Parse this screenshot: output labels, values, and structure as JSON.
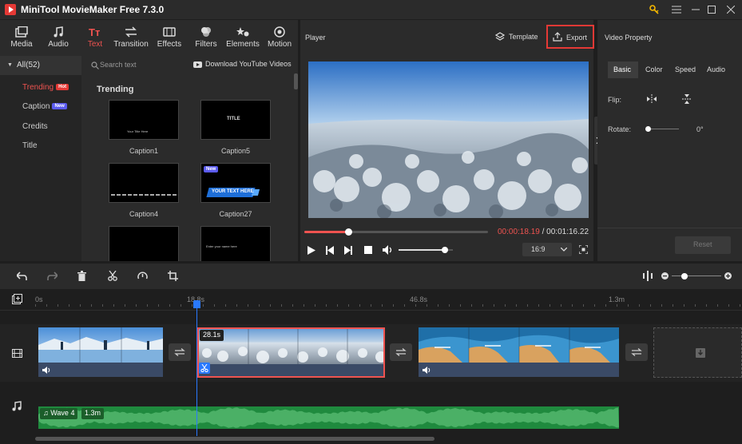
{
  "app": {
    "title": "MiniTool MovieMaker Free 7.3.0"
  },
  "toolbar_tabs": [
    {
      "label": "Media"
    },
    {
      "label": "Audio"
    },
    {
      "label": "Text"
    },
    {
      "label": "Transition"
    },
    {
      "label": "Effects"
    },
    {
      "label": "Filters"
    },
    {
      "label": "Elements"
    },
    {
      "label": "Motion"
    }
  ],
  "categories": {
    "all_label": "All(52)",
    "items": [
      {
        "label": "Trending",
        "badge": "Hot"
      },
      {
        "label": "Caption",
        "badge": "New"
      },
      {
        "label": "Credits"
      },
      {
        "label": "Title"
      }
    ]
  },
  "search": {
    "placeholder": "Search text"
  },
  "download_label": "Download YouTube Videos",
  "gallery": {
    "section": "Trending",
    "items": [
      {
        "label": "Caption1",
        "text": "Your Title Here"
      },
      {
        "label": "Caption5",
        "text": "TITLE"
      },
      {
        "label": "Caption4",
        "text": ""
      },
      {
        "label": "Caption27",
        "text": "YOUR TEXT HERE",
        "badge": "New"
      },
      {
        "label": "",
        "text": ""
      },
      {
        "label": "",
        "text": "Enter your name here"
      }
    ]
  },
  "player": {
    "title": "Player",
    "template_label": "Template",
    "export_label": "Export",
    "current_time": "00:00:18.19",
    "separator": "/",
    "total_time": "00:01:16.22",
    "aspect": "16:9",
    "progress": 0.24,
    "volume": 0.85
  },
  "property": {
    "title": "Video Property",
    "tabs": [
      "Basic",
      "Color",
      "Speed",
      "Audio"
    ],
    "flip_label": "Flip:",
    "rotate_label": "Rotate:",
    "rotate_value": "0°",
    "reset_label": "Reset"
  },
  "timeline": {
    "ruler": [
      "0s",
      "18.8s",
      "46.8s",
      "1.3m"
    ],
    "clip2_duration": "28.1s",
    "audio_name": "Wave 4",
    "audio_duration": "1.3m"
  },
  "colors": {
    "accent": "#ef5350",
    "export_border": "#e53935",
    "playhead": "#2979ff",
    "audio": "#2e8b45"
  }
}
